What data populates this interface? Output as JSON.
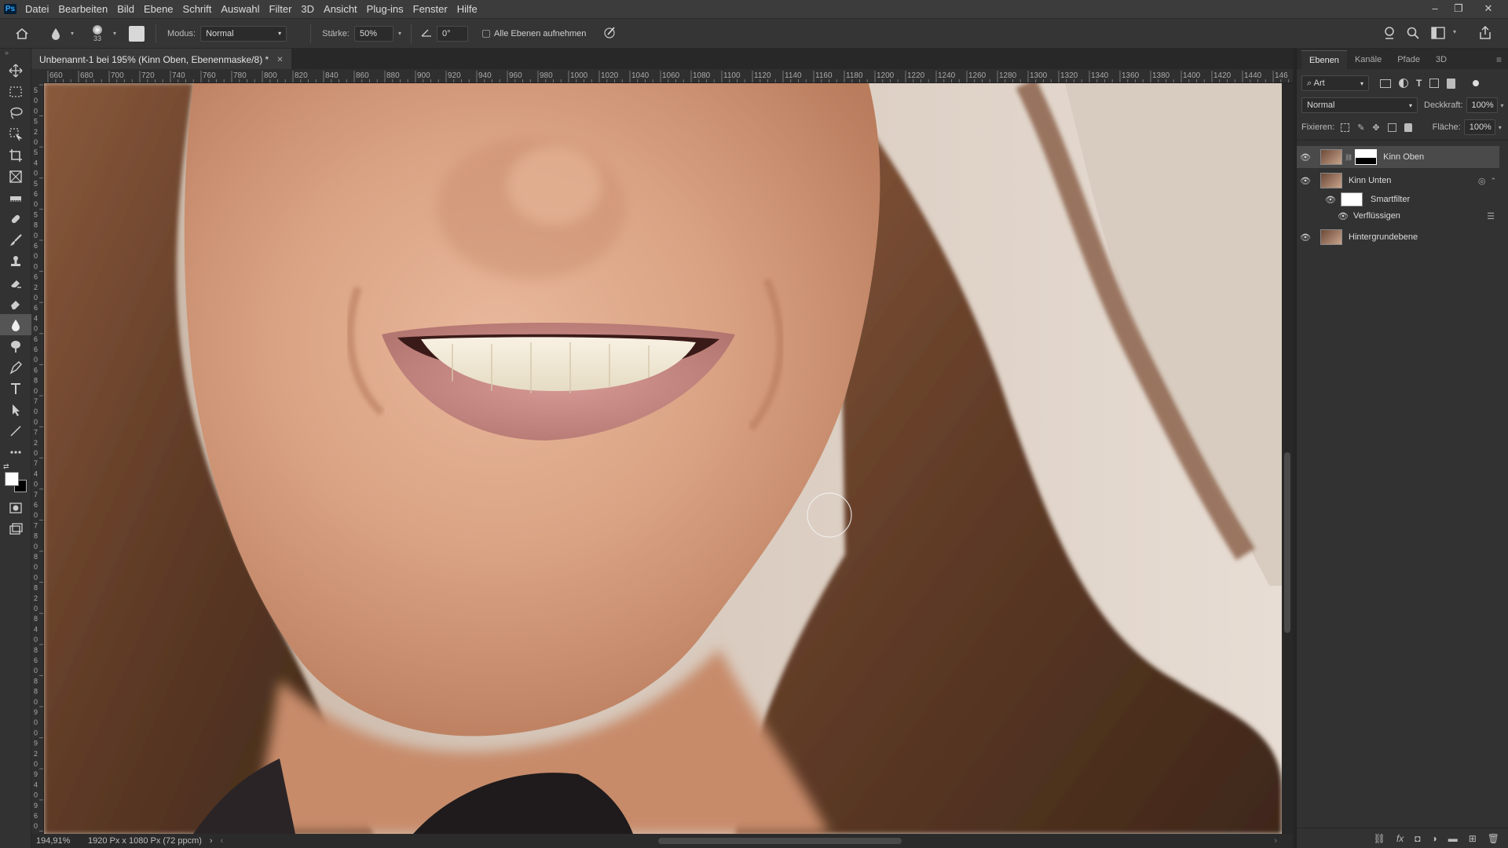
{
  "app": {
    "logo": "Ps"
  },
  "menu": [
    "Datei",
    "Bearbeiten",
    "Bild",
    "Ebene",
    "Schrift",
    "Auswahl",
    "Filter",
    "3D",
    "Ansicht",
    "Plug-ins",
    "Fenster",
    "Hilfe"
  ],
  "window_controls": {
    "minimize": "–",
    "restore": "❐",
    "close": "✕"
  },
  "options": {
    "brush_size": "33",
    "mode_label": "Modus:",
    "mode_value": "Normal",
    "strength_label": "Stärke:",
    "strength_value": "50%",
    "angle_value": "0°",
    "all_layers_label": "Alle Ebenen aufnehmen"
  },
  "document": {
    "tab_title": "Unbenannt-1 bei 195% (Kinn Oben, Ebenenmaske/8) *",
    "zoom": "194,91%",
    "info": "1920 Px x 1080 Px (72 ppcm)"
  },
  "ruler_top": [
    "660",
    "680",
    "700",
    "720",
    "740",
    "760",
    "780",
    "800",
    "820",
    "840",
    "860",
    "880",
    "900",
    "920",
    "940",
    "960",
    "980",
    "1000",
    "1020",
    "1040",
    "1060",
    "1080",
    "1100",
    "1120",
    "1140",
    "1160",
    "1180",
    "1200",
    "1220",
    "1240",
    "1260",
    "1280",
    "1300",
    "1320",
    "1340",
    "1360",
    "1380",
    "1400",
    "1420",
    "1440",
    "146"
  ],
  "ruler_left": [
    "5",
    "0",
    "0",
    "5",
    "2",
    "0",
    "5",
    "4",
    "0",
    "5",
    "6",
    "0",
    "5",
    "8",
    "0",
    "6",
    "0",
    "0",
    "6",
    "2",
    "0",
    "6",
    "4",
    "0",
    "6",
    "6",
    "0",
    "6",
    "8",
    "0",
    "7",
    "0",
    "0",
    "7",
    "2",
    "0",
    "7",
    "4",
    "0",
    "7",
    "6",
    "0",
    "7",
    "8",
    "0",
    "8",
    "0",
    "0",
    "8",
    "2",
    "0",
    "8",
    "4",
    "0",
    "8",
    "6",
    "0",
    "8",
    "8",
    "0",
    "9",
    "0",
    "0",
    "9",
    "2",
    "0",
    "9",
    "4",
    "0",
    "9",
    "6",
    "0",
    "9",
    "8",
    "0"
  ],
  "panel": {
    "tabs": [
      "Ebenen",
      "Kanäle",
      "Pfade",
      "3D"
    ],
    "filter_label": "Art",
    "blend_mode": "Normal",
    "opacity_label": "Deckkraft:",
    "opacity_value": "100%",
    "lock_label": "Fixieren:",
    "fill_label": "Fläche:",
    "fill_value": "100%",
    "layers": [
      {
        "name": "Kinn Oben"
      },
      {
        "name": "Kinn Unten"
      },
      {
        "name": "Smartfilter"
      },
      {
        "name": "Verflüssigen"
      },
      {
        "name": "Hintergrundebene"
      }
    ]
  }
}
